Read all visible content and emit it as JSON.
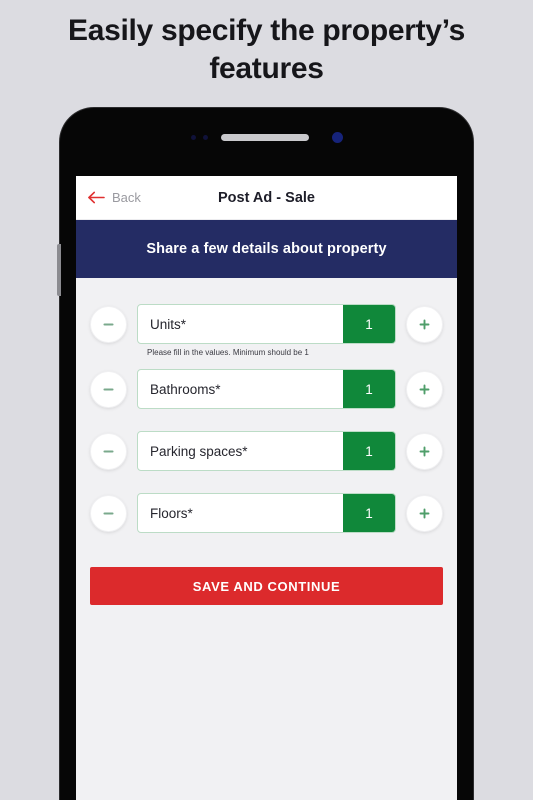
{
  "promo": {
    "headline": "Easily specify the property’s features"
  },
  "phone": {
    "hardware": {
      "speaker": "speaker-grille",
      "front_camera": "front-camera",
      "sensor": "proximity-sensor",
      "side_button": "volume-button"
    }
  },
  "navbar": {
    "back_label": "Back",
    "back_icon": "arrow-left-icon",
    "title": "Post Ad - Sale"
  },
  "banner": {
    "text": "Share a few details about property"
  },
  "form": {
    "decrement_icon": "minus-icon",
    "increment_icon": "plus-icon",
    "fields": [
      {
        "label": "Units*",
        "value": "1",
        "helper": "Please fill in the values. Minimum should be 1"
      },
      {
        "label": "Bathrooms*",
        "value": "1",
        "helper": ""
      },
      {
        "label": "Parking spaces*",
        "value": "1",
        "helper": ""
      },
      {
        "label": "Floors*",
        "value": "1",
        "helper": ""
      }
    ]
  },
  "cta": {
    "label": "SAVE AND CONTINUE"
  },
  "colors": {
    "page_background": "#dcdce1",
    "banner_navy": "#242c64",
    "accent_green": "#10883a",
    "field_border_green": "#bcdcc6",
    "cta_red": "#dc2a2c",
    "back_arrow_red": "#e03030",
    "screen_background": "#f1f1f3"
  }
}
